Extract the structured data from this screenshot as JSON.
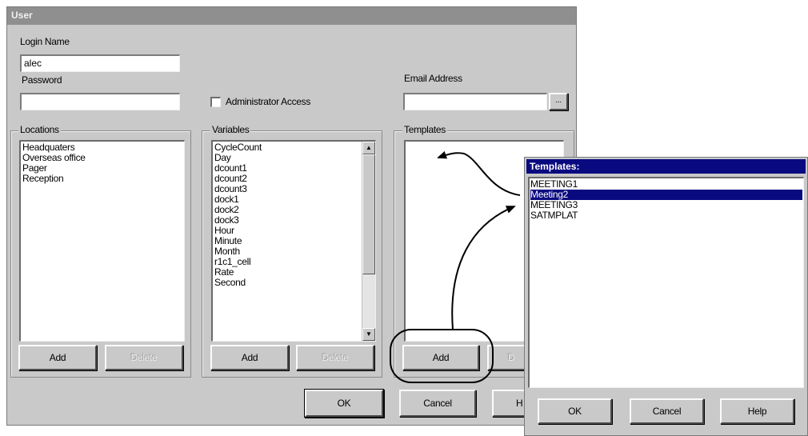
{
  "dialog": {
    "title": "User",
    "login_name_label": "Login Name",
    "login_name_value": "alec",
    "password_label": "Password",
    "password_value": "",
    "admin_access_label": "Administrator Access",
    "email_label": "Email Address",
    "email_value": "",
    "browse_label": "...",
    "locations": {
      "title": "Locations",
      "items": [
        "Headquaters",
        "Overseas office",
        "Pager",
        "Reception"
      ],
      "add_label": "Add",
      "delete_label": "Delete"
    },
    "variables": {
      "title": "Variables",
      "items": [
        "CycleCount",
        "Day",
        "dcount1",
        "dcount2",
        "dcount3",
        "dock1",
        "dock2",
        "dock3",
        "Hour",
        "Minute",
        "Month",
        "r1c1_cell",
        "Rate",
        "Second"
      ],
      "add_label": "Add",
      "delete_label": "Delete"
    },
    "templates": {
      "title": "Templates",
      "items": [],
      "add_label": "Add",
      "delete_label": "D"
    },
    "ok_label": "OK",
    "cancel_label": "Cancel",
    "help_label": "H"
  },
  "popup": {
    "title": "Templates",
    "items": [
      "MEETING1",
      "Meeting2",
      "MEETING3",
      "SATMPLAT"
    ],
    "selected_index": 1,
    "ok_label": "OK",
    "cancel_label": "Cancel",
    "help_label": "Help"
  },
  "colors": {
    "dialog_bg": "#c9c9c9",
    "selection": "#0a0a80"
  }
}
